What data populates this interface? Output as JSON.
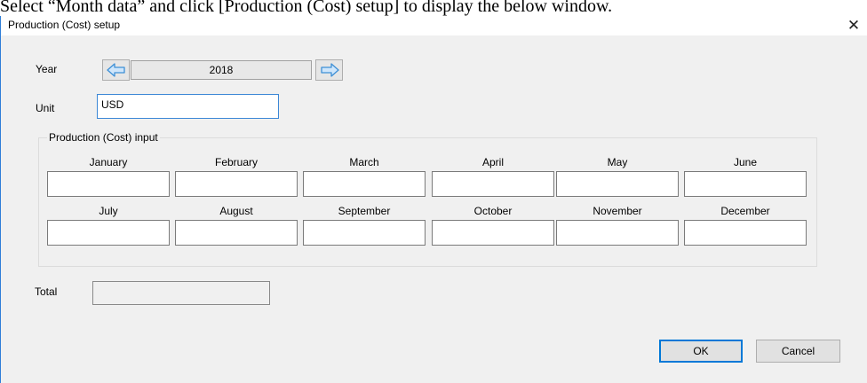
{
  "caption": "Select “Month data” and click [Production (Cost) setup] to display the below window.",
  "window": {
    "title": "Production (Cost) setup",
    "close_glyph": "✕"
  },
  "year": {
    "label": "Year",
    "value": "2018"
  },
  "unit": {
    "label": "Unit",
    "value": "USD"
  },
  "group": {
    "title": "Production (Cost) input",
    "months": [
      "January",
      "February",
      "March",
      "April",
      "May",
      "June",
      "July",
      "August",
      "September",
      "October",
      "November",
      "December"
    ]
  },
  "total": {
    "label": "Total",
    "value": ""
  },
  "buttons": {
    "ok": "OK",
    "cancel": "Cancel"
  },
  "icons": {
    "prev": "arrow-left-icon",
    "next": "arrow-right-icon"
  },
  "colors": {
    "focus_blue": "#0078d7",
    "arrow_blue": "#4fa3e0"
  }
}
